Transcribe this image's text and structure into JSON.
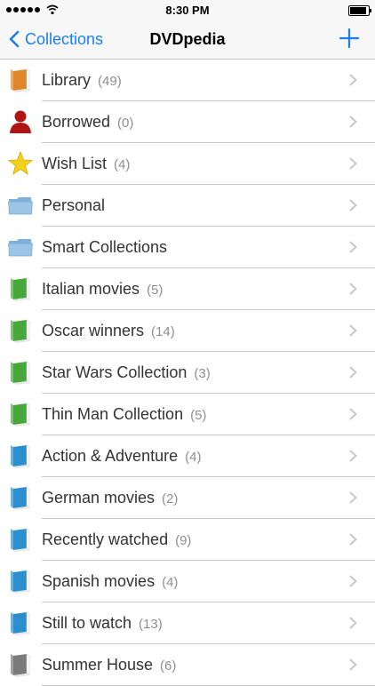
{
  "status": {
    "time": "8:30 PM",
    "battery_level": 0.9
  },
  "nav": {
    "back_label": "Collections",
    "title": "DVDpedia"
  },
  "items": [
    {
      "label": "Library",
      "count": "(49)",
      "icon": "book-orange-icon",
      "color": "#e0862a"
    },
    {
      "label": "Borrowed",
      "count": "(0)",
      "icon": "person-red-icon",
      "color": "#b01515"
    },
    {
      "label": "Wish List",
      "count": "(4)",
      "icon": "star-icon",
      "color": "#f5d11f"
    },
    {
      "label": "Personal",
      "count": "",
      "icon": "folder-icon",
      "color": "#9bc4e6"
    },
    {
      "label": "Smart Collections",
      "count": "",
      "icon": "folder-icon",
      "color": "#9bc4e6"
    },
    {
      "label": "Italian movies",
      "count": "(5)",
      "icon": "book-green-icon",
      "color": "#46a83a"
    },
    {
      "label": "Oscar winners",
      "count": "(14)",
      "icon": "book-green-icon",
      "color": "#46a83a"
    },
    {
      "label": "Star Wars Collection",
      "count": "(3)",
      "icon": "book-green-icon",
      "color": "#46a83a"
    },
    {
      "label": "Thin Man Collection",
      "count": "(5)",
      "icon": "book-green-icon",
      "color": "#46a83a"
    },
    {
      "label": "Action & Adventure",
      "count": "(4)",
      "icon": "book-blue-icon",
      "color": "#2a8ecf"
    },
    {
      "label": "German movies",
      "count": "(2)",
      "icon": "book-blue-icon",
      "color": "#2a8ecf"
    },
    {
      "label": "Recently watched",
      "count": "(9)",
      "icon": "book-blue-icon",
      "color": "#2a8ecf"
    },
    {
      "label": "Spanish movies",
      "count": "(4)",
      "icon": "book-blue-icon",
      "color": "#2a8ecf"
    },
    {
      "label": "Still to watch",
      "count": "(13)",
      "icon": "book-blue-icon",
      "color": "#2a8ecf"
    },
    {
      "label": "Summer House",
      "count": "(6)",
      "icon": "book-gray-icon",
      "color": "#7a7a7a"
    }
  ],
  "colors": {
    "accent": "#1a7ef3",
    "separator": "#c8c7cc",
    "count": "#8e8e93"
  }
}
